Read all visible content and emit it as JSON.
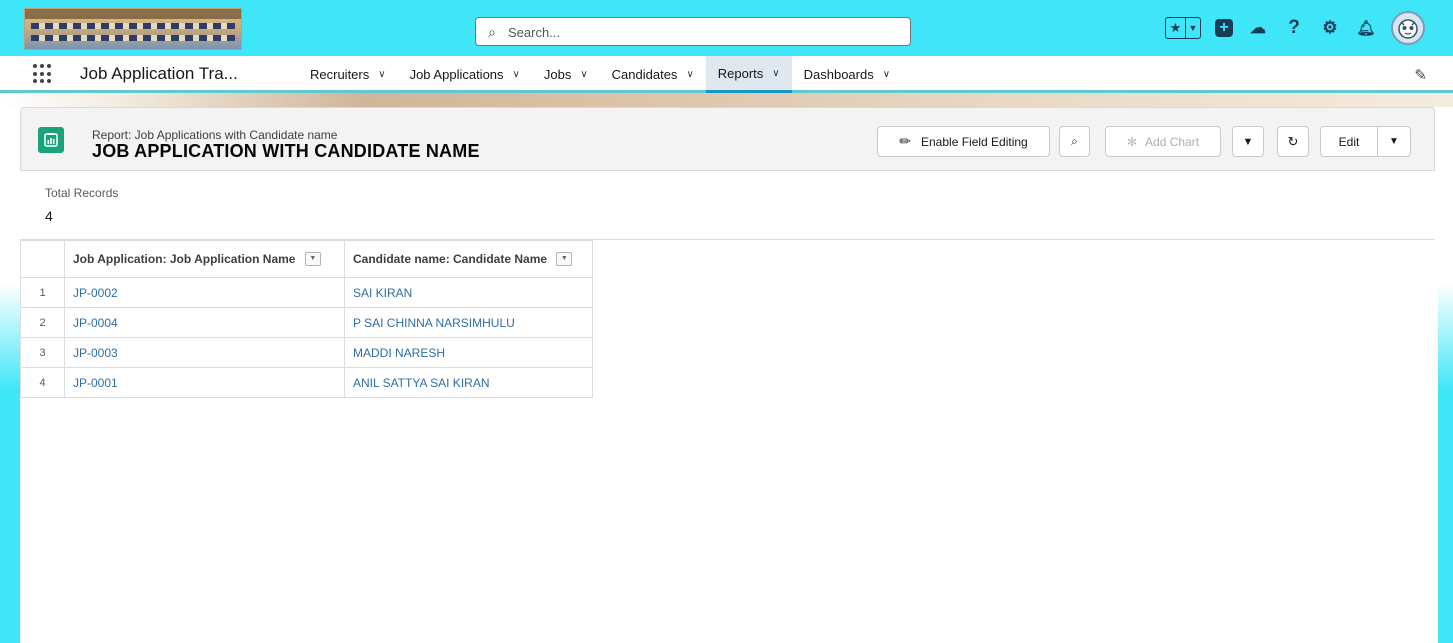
{
  "header": {
    "search_placeholder": "Search..."
  },
  "nav": {
    "app_name": "Job Application Tra...",
    "items": [
      {
        "label": "Recruiters"
      },
      {
        "label": "Job Applications"
      },
      {
        "label": "Jobs"
      },
      {
        "label": "Candidates"
      },
      {
        "label": "Reports",
        "active": true
      },
      {
        "label": "Dashboards"
      }
    ]
  },
  "report": {
    "subtitle": "Report: Job Applications with Candidate name",
    "title": "JOB APPLICATION WITH CANDIDATE NAME",
    "buttons": {
      "enable_field_editing": "Enable Field Editing",
      "add_chart": "Add Chart",
      "edit": "Edit"
    },
    "total_records_label": "Total Records",
    "total_records_value": "4",
    "columns": [
      "Job Application: Job Application Name",
      "Candidate name: Candidate Name"
    ],
    "rows": [
      {
        "num": "1",
        "job_app": "JP-0002",
        "candidate": "SAI KIRAN"
      },
      {
        "num": "2",
        "job_app": "JP-0004",
        "candidate": "P SAI CHINNA NARSIMHULU"
      },
      {
        "num": "3",
        "job_app": "JP-0003",
        "candidate": "MADDI NARESH"
      },
      {
        "num": "4",
        "job_app": "JP-0001",
        "candidate": "ANIL SATTYA SAI KIRAN"
      }
    ]
  },
  "colors": {
    "header_bg": "#3ee6f7",
    "report_icon": "#1aa37a",
    "link": "#2e6ea6",
    "active_tab_underline": "#1b96c4"
  },
  "icons": {
    "search": "search-icon",
    "favorites": "star-icon",
    "global_actions": "plus-icon",
    "trailhead": "trailhead-icon",
    "help": "help-icon",
    "setup": "gear-icon",
    "notifications": "bell-icon",
    "app_launcher": "app-launcher-icon"
  }
}
